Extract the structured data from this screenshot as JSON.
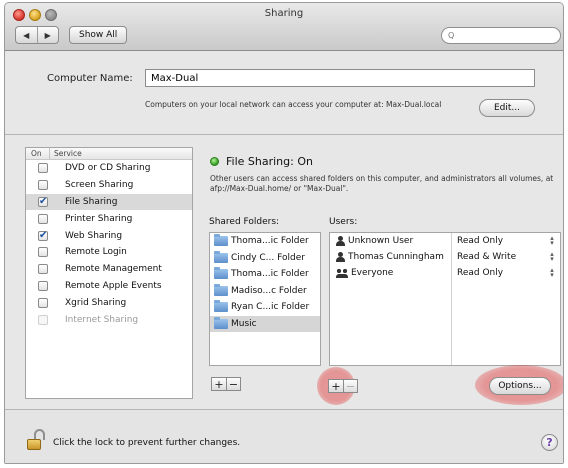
{
  "window": {
    "title": "Sharing"
  },
  "toolbar": {
    "back_label": "◀",
    "forward_label": "▶",
    "show_all_label": "Show All",
    "search_placeholder": "",
    "search_icon": "Q"
  },
  "computer_name": {
    "label": "Computer Name:",
    "value": "Max-Dual",
    "help_text": "Computers on your local network can access your computer at: Max-Dual.local",
    "edit_button": "Edit..."
  },
  "services": {
    "header_on": "On",
    "header_service": "Service",
    "items": [
      {
        "label": "DVD or CD Sharing",
        "checked": "",
        "selected": false,
        "dim": false
      },
      {
        "label": "Screen Sharing",
        "checked": "",
        "selected": false,
        "dim": false
      },
      {
        "label": "File Sharing",
        "checked": "✔",
        "selected": true,
        "dim": false
      },
      {
        "label": "Printer Sharing",
        "checked": "",
        "selected": false,
        "dim": false
      },
      {
        "label": "Web Sharing",
        "checked": "✔",
        "selected": false,
        "dim": false
      },
      {
        "label": "Remote Login",
        "checked": "",
        "selected": false,
        "dim": false
      },
      {
        "label": "Remote Management",
        "checked": "",
        "selected": false,
        "dim": false
      },
      {
        "label": "Remote Apple Events",
        "checked": "",
        "selected": false,
        "dim": false
      },
      {
        "label": "Xgrid Sharing",
        "checked": "",
        "selected": false,
        "dim": false
      },
      {
        "label": "Internet Sharing",
        "checked": "",
        "selected": false,
        "dim": true
      }
    ]
  },
  "file_sharing": {
    "status": "File Sharing: On",
    "status_color": "#2f9e1e",
    "description": "Other users can access shared folders on this computer, and administrators all volumes, at afp://Max-Dual.home/ or \"Max-Dual\".",
    "shared_folders_label": "Shared Folders:",
    "users_label": "Users:",
    "folders": [
      {
        "name": "Thoma...ic Folder",
        "selected": false
      },
      {
        "name": "Cindy C...  Folder",
        "selected": false
      },
      {
        "name": "Thoma...ic Folder",
        "selected": false
      },
      {
        "name": "Madiso...c Folder",
        "selected": false
      },
      {
        "name": "Ryan C...ic Folder",
        "selected": false
      },
      {
        "name": "Music",
        "selected": true
      }
    ],
    "users": [
      {
        "name": "Unknown User",
        "permission": "Read Only",
        "icon": "person-icon"
      },
      {
        "name": "Thomas Cunningham",
        "permission": "Read & Write",
        "icon": "person-icon"
      },
      {
        "name": "Everyone",
        "permission": "Read Only",
        "icon": "group-icon"
      }
    ],
    "folders_add": "+",
    "folders_remove": "−",
    "users_add": "+",
    "users_remove": "−",
    "options_button": "Options..."
  },
  "footer": {
    "lock_text": "Click the lock to prevent further changes.",
    "help_label": "?"
  },
  "colors": {
    "highlight": "#e12323",
    "selection": "#d9d9d9"
  }
}
